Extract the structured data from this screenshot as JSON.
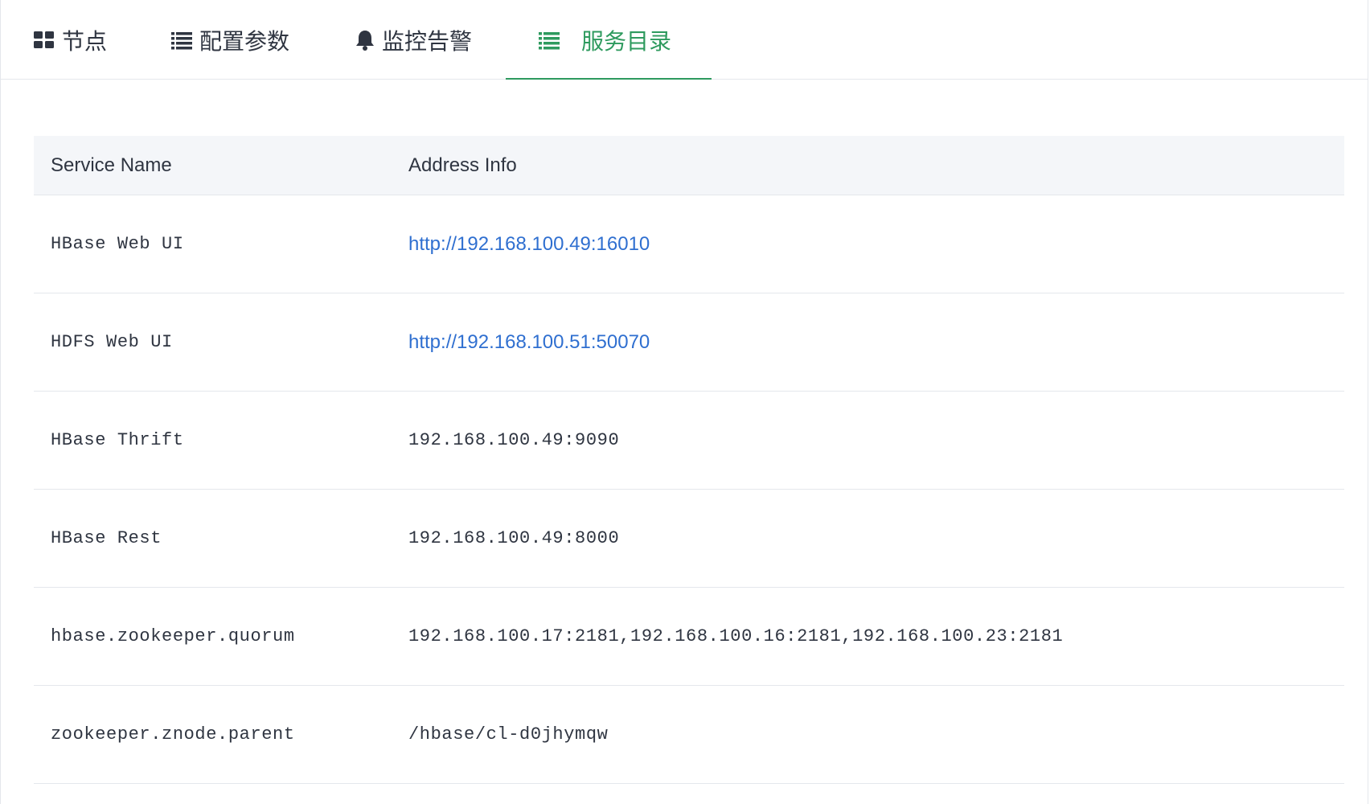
{
  "tabs": [
    {
      "label": "节点",
      "icon": "grid-icon",
      "active": false
    },
    {
      "label": "配置参数",
      "icon": "list-icon",
      "active": false
    },
    {
      "label": "监控告警",
      "icon": "bell-icon",
      "active": false
    },
    {
      "label": "服务目录",
      "icon": "list-icon",
      "active": true
    }
  ],
  "colors": {
    "accent": "#2e9a5e",
    "link": "#2f6fd0",
    "header_bg": "#f4f6f9",
    "border": "#e4e7ec",
    "text": "#2f3541"
  },
  "table": {
    "headers": [
      "Service Name",
      "Address Info"
    ],
    "rows": [
      {
        "name": "HBase Web UI",
        "address": "http://192.168.100.49:16010",
        "is_link": true
      },
      {
        "name": "HDFS Web UI",
        "address": "http://192.168.100.51:50070",
        "is_link": true
      },
      {
        "name": "HBase Thrift",
        "address": "192.168.100.49:9090",
        "is_link": false
      },
      {
        "name": "HBase Rest",
        "address": "192.168.100.49:8000",
        "is_link": false
      },
      {
        "name": "hbase.zookeeper.quorum",
        "address": "192.168.100.17:2181,192.168.100.16:2181,192.168.100.23:2181",
        "is_link": false
      },
      {
        "name": "zookeeper.znode.parent",
        "address": "/hbase/cl-d0jhymqw",
        "is_link": false
      }
    ]
  }
}
